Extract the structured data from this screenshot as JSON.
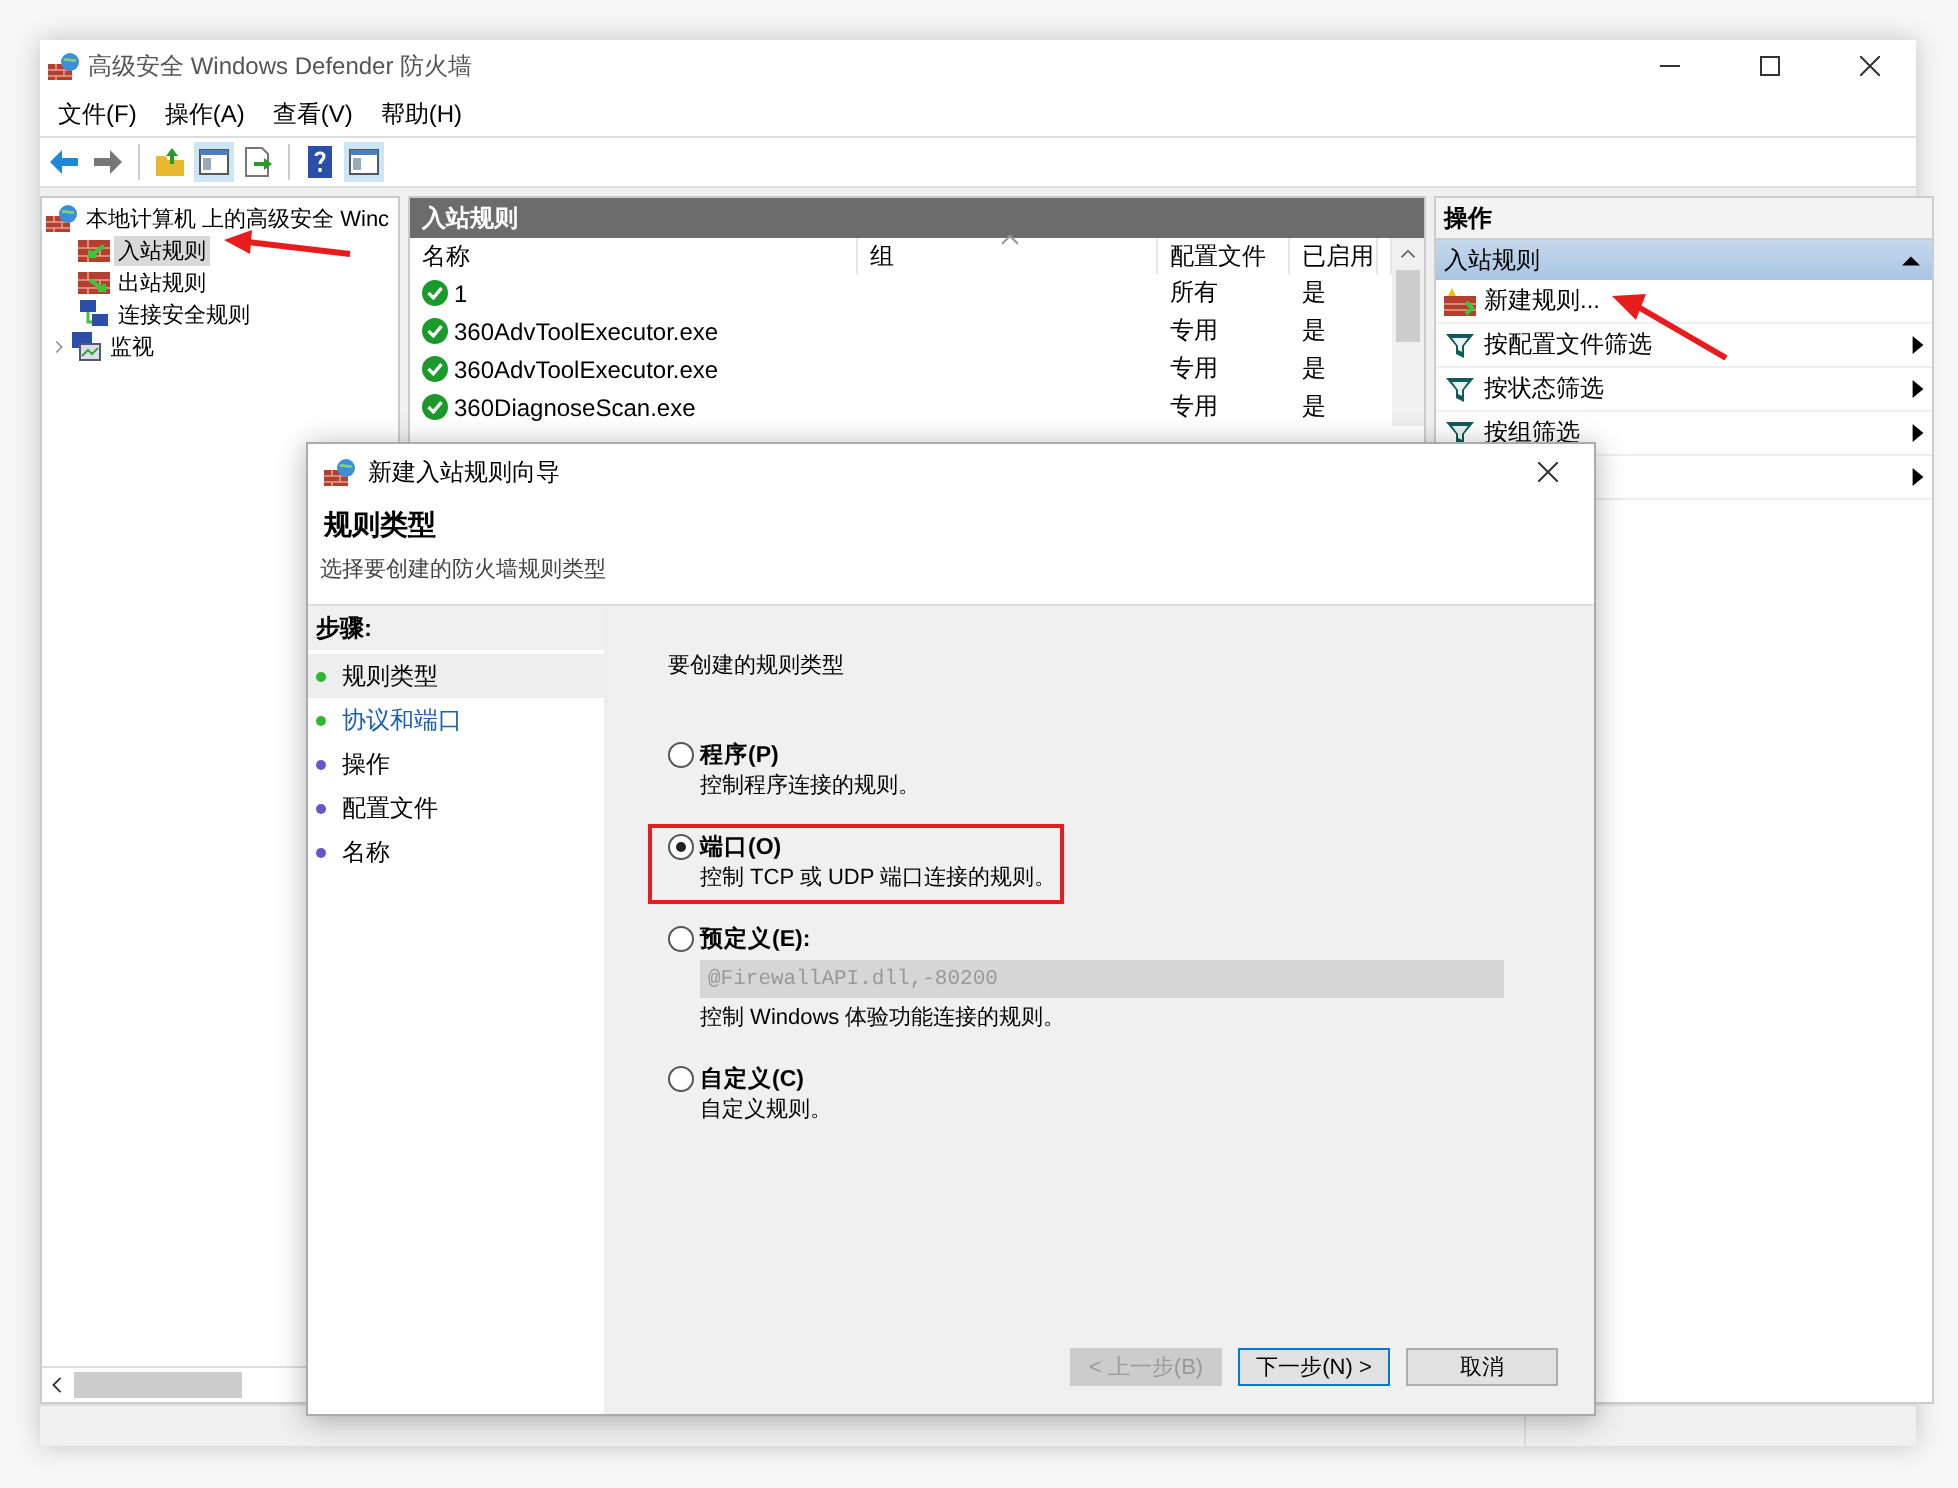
{
  "window": {
    "title": "高级安全 Windows Defender 防火墙"
  },
  "menu": [
    "文件(F)",
    "操作(A)",
    "查看(V)",
    "帮助(H)"
  ],
  "toolbar": [
    {
      "kind": "back",
      "pressed": false
    },
    {
      "kind": "forward",
      "pressed": false
    },
    {
      "kind": "up",
      "pressed": false
    },
    {
      "kind": "pane",
      "pressed": true
    },
    {
      "kind": "export",
      "pressed": false
    },
    {
      "kind": "help",
      "pressed": false
    },
    {
      "kind": "pane",
      "pressed": true
    }
  ],
  "tree": {
    "label": "本地计算机 上的高级安全 Winc",
    "children": [
      {
        "label": "入站规则",
        "kind": "inbound",
        "selected": true
      },
      {
        "label": "出站规则",
        "kind": "outbound",
        "selected": false
      },
      {
        "label": "连接安全规则",
        "kind": "security",
        "selected": false
      },
      {
        "label": "监视",
        "kind": "monitor",
        "selected": false,
        "expanded": false
      }
    ]
  },
  "rules_pane": {
    "title": "入站规则",
    "columns": [
      "名称",
      "组",
      "配置文件",
      "已启用"
    ],
    "rows": [
      {
        "name": "1",
        "profile": "所有",
        "enabled": "是"
      },
      {
        "name": "360AdvToolExecutor.exe",
        "profile": "专用",
        "enabled": "是"
      },
      {
        "name": "360AdvToolExecutor.exe",
        "profile": "专用",
        "enabled": "是"
      },
      {
        "name": "360DiagnoseScan.exe",
        "profile": "专用",
        "enabled": "是"
      }
    ]
  },
  "actions_pane": {
    "title": "操作",
    "section": {
      "title": "入站规则",
      "expanded": true
    },
    "items": [
      {
        "kind": "new",
        "label": "新建规则...",
        "submenu": false
      },
      {
        "kind": "filter",
        "label": "按配置文件筛选",
        "submenu": true
      },
      {
        "kind": "filter",
        "label": "按状态筛选",
        "submenu": true
      },
      {
        "kind": "filter",
        "label": "按组筛选",
        "submenu": true
      },
      {
        "kind": "hidden",
        "submenu": true
      }
    ]
  },
  "dialog": {
    "title": "新建入站规则向导",
    "heading": "规则类型",
    "subheading": "选择要创建的防火墙规则类型",
    "steps_title": "步骤:",
    "steps": [
      {
        "label": "规则类型",
        "selected": true,
        "link": false,
        "color": "#2eb82e"
      },
      {
        "label": "协议和端口",
        "selected": false,
        "link": true,
        "color": "#2eb82e"
      },
      {
        "label": "操作",
        "selected": false,
        "link": false,
        "color": "#6655cc"
      },
      {
        "label": "配置文件",
        "selected": false,
        "link": false,
        "color": "#6655cc"
      },
      {
        "label": "名称",
        "selected": false,
        "link": false,
        "color": "#6655cc"
      }
    ],
    "prompt": "要创建的规则类型",
    "options": [
      {
        "label": "程序(P)",
        "description": "控制程序连接的规则。",
        "selected": false
      },
      {
        "label": "端口(O)",
        "description": "控制 TCP 或 UDP 端口连接的规则。",
        "selected": true,
        "highlighted": true
      },
      {
        "label": "预定义(E):",
        "dropdown": {
          "value": "@FirewallAPI.dll,-80200",
          "disabled": true
        },
        "description": "控制 Windows 体验功能连接的规则。",
        "selected": false
      },
      {
        "label": "自定义(C)",
        "description": "自定义规则。",
        "selected": false
      }
    ],
    "buttons": [
      {
        "label": "< 上一步(B)",
        "disabled": true,
        "focused": false
      },
      {
        "label": "下一步(N) >",
        "disabled": false,
        "focused": true
      },
      {
        "label": "取消",
        "disabled": false,
        "focused": false
      }
    ]
  }
}
